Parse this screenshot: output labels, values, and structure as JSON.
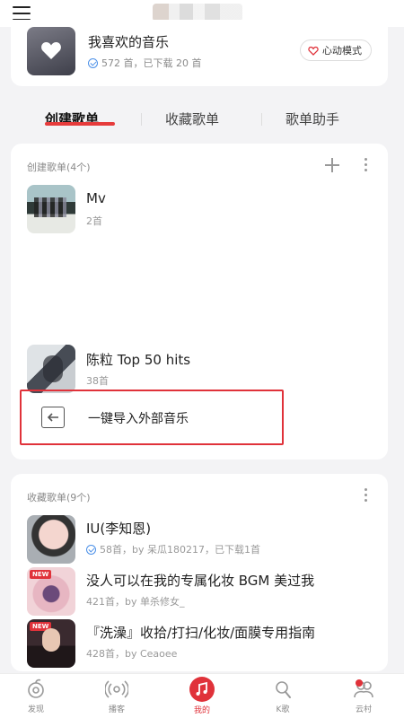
{
  "favorites": {
    "title": "我喜欢的音乐",
    "meta": "572 首，已下载 20 首",
    "heart_mode_label": "心动模式"
  },
  "tabs": [
    "创建歌单",
    "收藏歌单",
    "歌单助手"
  ],
  "created": {
    "section_title": "创建歌单(4个)",
    "playlists": [
      {
        "title": "Mv",
        "meta": "2首"
      },
      {
        "title": "陈粒 Top 50 hits",
        "meta": "38首"
      }
    ],
    "import_label": "一键导入外部音乐"
  },
  "collected": {
    "section_title": "收藏歌单(9个)",
    "playlists": [
      {
        "title": "IU(李知恩)",
        "meta": "58首，by 呆瓜180217，已下载1首"
      },
      {
        "title": "没人可以在我的专属化妆 BGM 美过我",
        "meta": "421首，by 单杀修女_"
      },
      {
        "title": "『洗澡』收拾/打扫/化妆/面膜专用指南",
        "meta": "428首，by Ceaoee"
      }
    ]
  },
  "nav": [
    {
      "label": "发现",
      "icon": "discover-icon"
    },
    {
      "label": "播客",
      "icon": "podcast-icon"
    },
    {
      "label": "我的",
      "icon": "music-note-icon"
    },
    {
      "label": "K歌",
      "icon": "karaoke-icon"
    },
    {
      "label": "云村",
      "icon": "community-icon"
    }
  ],
  "badge": {
    "new": "NEW"
  },
  "colors": {
    "accent": "#e0323a",
    "check": "#4c90e8"
  }
}
